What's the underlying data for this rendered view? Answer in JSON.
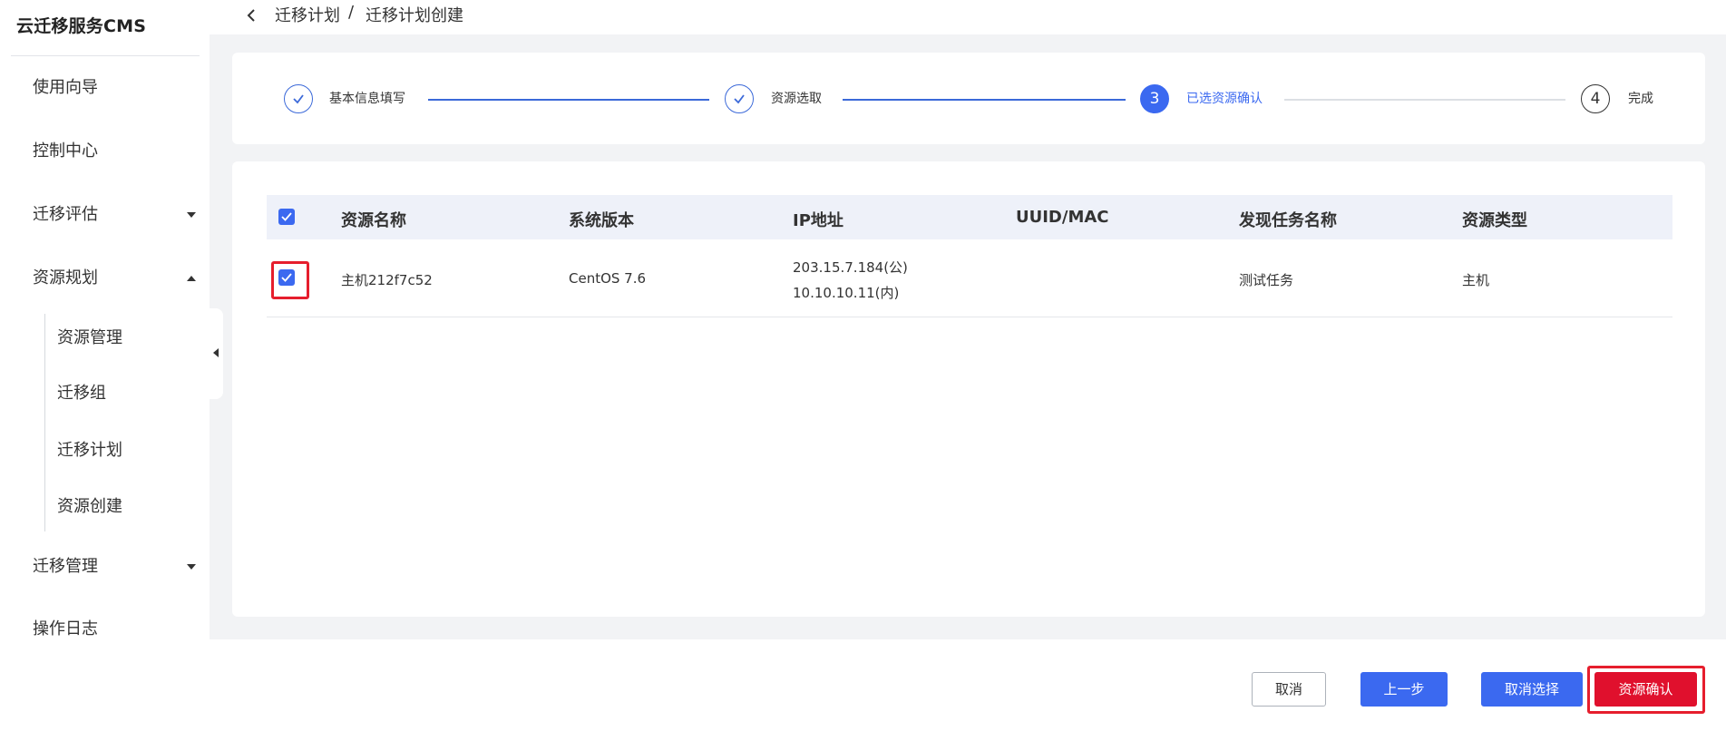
{
  "app": {
    "brand": "云迁移服务CMS"
  },
  "sidebar": {
    "items": [
      {
        "label": "使用向导"
      },
      {
        "label": "控制中心"
      },
      {
        "label": "迁移评估"
      },
      {
        "label": "资源规划"
      },
      {
        "label": "迁移管理"
      },
      {
        "label": "操作日志"
      }
    ],
    "sub_items": [
      {
        "label": "资源管理"
      },
      {
        "label": "迁移组"
      },
      {
        "label": "迁移计划"
      },
      {
        "label": "资源创建"
      }
    ]
  },
  "breadcrumb": {
    "level1": "迁移计划",
    "separator": "/",
    "level2": "迁移计划创建"
  },
  "steps": [
    {
      "label": "基本信息填写",
      "state": "done",
      "number": ""
    },
    {
      "label": "资源选取",
      "state": "done",
      "number": ""
    },
    {
      "label": "已选资源确认",
      "state": "active",
      "number": "3"
    },
    {
      "label": "完成",
      "state": "todo",
      "number": "4"
    }
  ],
  "table": {
    "columns": [
      "资源名称",
      "系统版本",
      "IP地址",
      "UUID/MAC",
      "发现任务名称",
      "资源类型"
    ],
    "rows": [
      {
        "name": "主机212f7c52",
        "os": "CentOS 7.6",
        "ip_public": "203.15.7.184(公)",
        "ip_private": "10.10.10.11(内)",
        "uuid": "",
        "task": "测试任务",
        "type": "主机"
      }
    ]
  },
  "footer": {
    "cancel": "取消",
    "prev": "上一步",
    "deselect": "取消选择",
    "confirm": "资源确认"
  },
  "colors": {
    "primary": "#3b69f0",
    "danger": "#e0102d",
    "highlight": "#e61e2d"
  }
}
